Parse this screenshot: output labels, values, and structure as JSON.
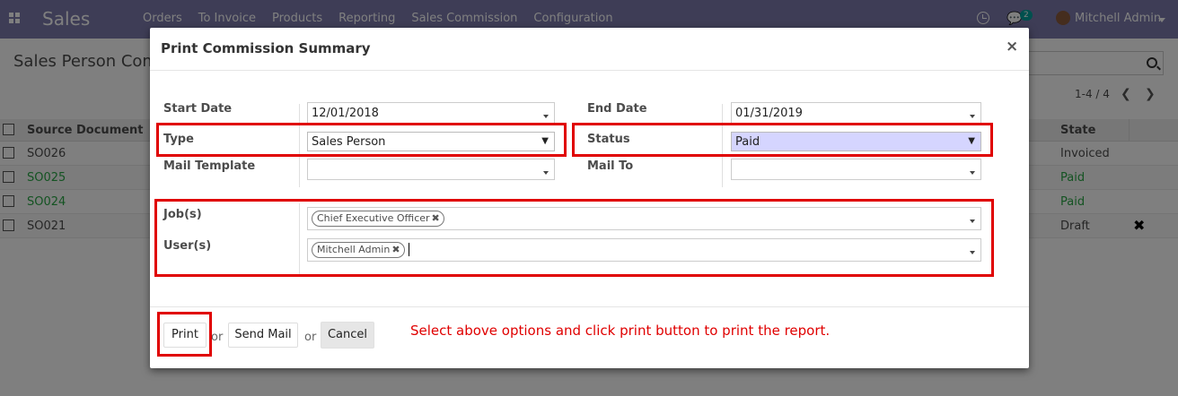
{
  "navbar": {
    "brand": "Sales",
    "menu": [
      "Orders",
      "To Invoice",
      "Products",
      "Reporting",
      "Sales Commission",
      "Configuration"
    ],
    "chat_count": "2",
    "user_name": "Mitchell Admin"
  },
  "control_panel": {
    "title": "Sales Person Commission",
    "pager": "1-4 / 4"
  },
  "list": {
    "columns": [
      "Source Document",
      "State"
    ],
    "rows": [
      {
        "source": "SO026",
        "state": "Invoiced"
      },
      {
        "source": "SO025",
        "state": "Paid"
      },
      {
        "source": "SO024",
        "state": "Paid"
      },
      {
        "source": "SO021",
        "state": "Draft"
      }
    ]
  },
  "modal": {
    "title": "Print Commission Summary",
    "close": "×",
    "labels": {
      "start_date": "Start Date",
      "end_date": "End Date",
      "type": "Type",
      "status": "Status",
      "mail_template": "Mail Template",
      "mail_to": "Mail To",
      "jobs": "Job(s)",
      "users": "User(s)"
    },
    "values": {
      "start_date": "12/01/2018",
      "end_date": "01/31/2019",
      "type": "Sales Person",
      "status": "Paid",
      "mail_template": "",
      "mail_to": "",
      "job_tag": "Chief Executive Officer",
      "user_tag": "Mitchell Admin"
    },
    "buttons": {
      "print": "Print",
      "send_mail": "Send Mail",
      "cancel": "Cancel",
      "or": "or"
    },
    "hint": "Select above options and click print button to print the report."
  },
  "colors": {
    "navbar": "#7c7bad",
    "highlight_box": "#e00000",
    "paid_green": "#28a745",
    "status_select": "#d5d5ff"
  }
}
